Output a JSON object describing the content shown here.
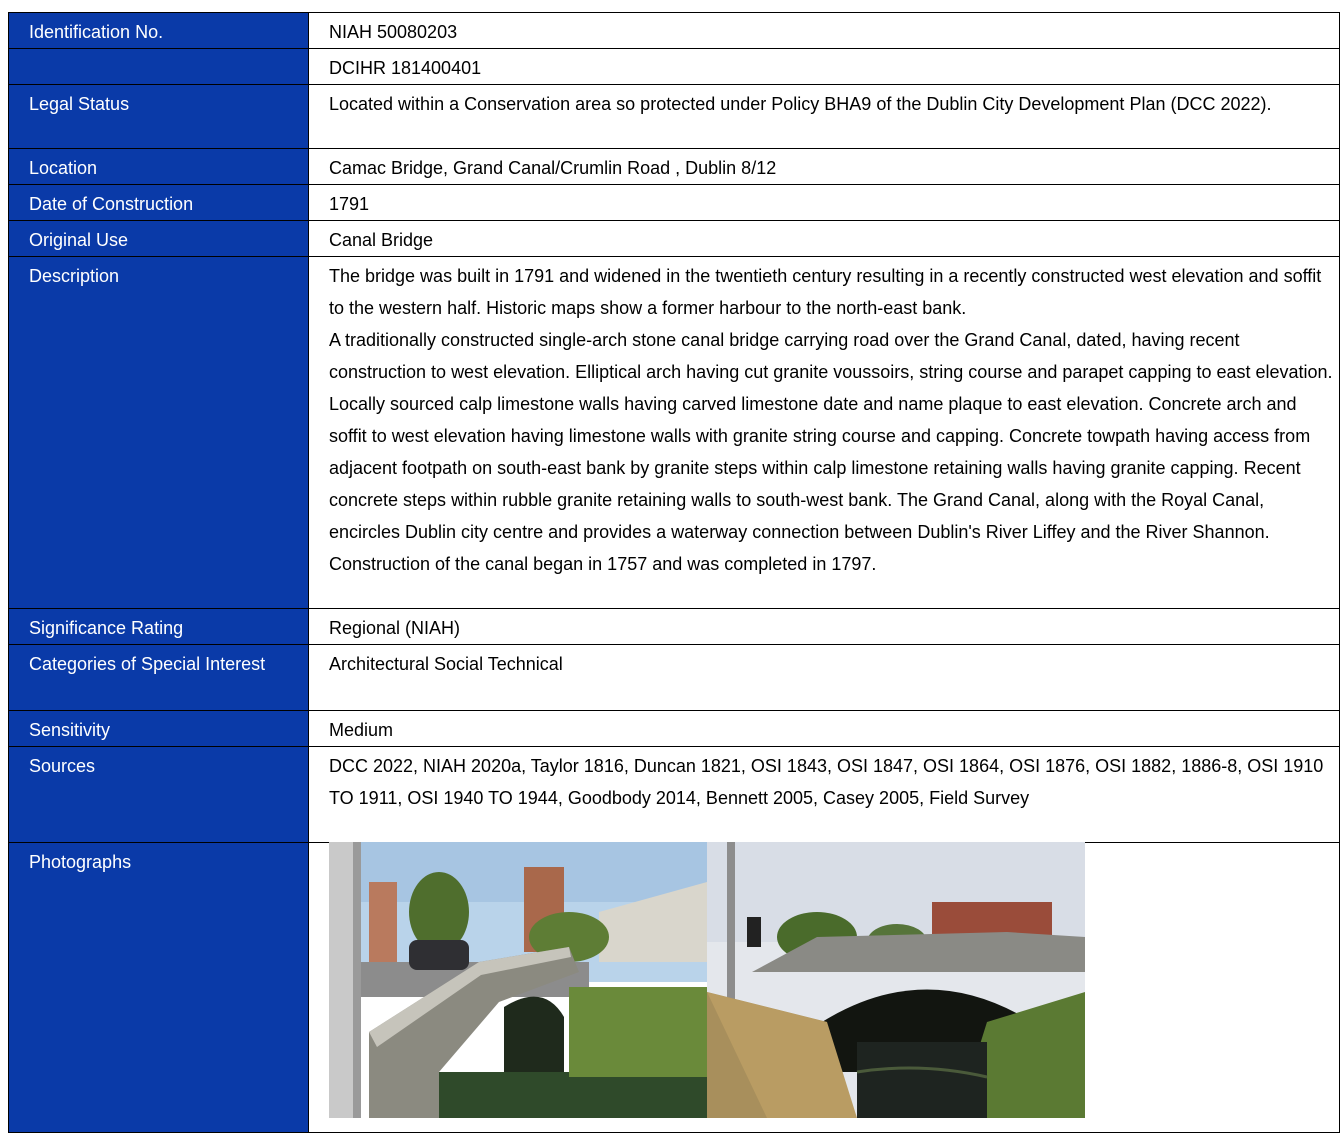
{
  "record": {
    "rows": [
      {
        "label": "Identification No.",
        "value": "NIAH 50080203"
      },
      {
        "label": "",
        "value": "DCIHR 181400401"
      },
      {
        "label": "Legal Status",
        "value": "Located within a Conservation area so protected under Policy BHA9 of the Dublin City Development Plan (DCC 2022)."
      },
      {
        "label": "Location",
        "value": "Camac Bridge, Grand Canal/Crumlin Road , Dublin 8/12"
      },
      {
        "label": "Date of Construction",
        "value": "1791"
      },
      {
        "label": "Original Use",
        "value": "Canal Bridge"
      },
      {
        "label": "Description",
        "value_p1": "The bridge was built in 1791 and widened in the twentieth century resulting in a recently constructed west elevation and soffit to the western half. Historic maps show a former harbour to the north-east bank.",
        "value_p2": "A traditionally constructed single-arch stone canal bridge carrying road over the Grand Canal, dated, having recent construction to west elevation. Elliptical arch having cut granite voussoirs, string course and parapet capping to east elevation. Locally sourced calp limestone walls having carved limestone date and name plaque to east elevation. Concrete arch and soffit to west elevation having limestone walls with granite string course and capping. Concrete towpath having access from adjacent footpath on south-east bank by granite steps within calp limestone retaining walls having granite capping. Recent concrete steps within rubble granite retaining walls to south-west bank. The Grand Canal, along with the Royal Canal, encircles Dublin city centre and provides a waterway connection between Dublin's River Liffey and the River Shannon. Construction of the canal began in 1757 and was completed in 1797."
      },
      {
        "label": "Significance Rating",
        "value": "Regional (NIAH)"
      },
      {
        "label": "Categories of Special Interest",
        "value": "Architectural Social Technical"
      },
      {
        "label": "Sensitivity",
        "value": "Medium"
      },
      {
        "label": "Sources",
        "value": "DCC 2022, NIAH 2020a, Taylor 1816, Duncan 1821, OSI 1843, OSI 1847, OSI 1864, OSI 1876, OSI 1882, 1886-8, OSI 1910 TO 1911, OSI 1940 TO 1944, Goodbody 2014, Bennett 2005, Casey 2005, Field Survey"
      },
      {
        "label": "Photographs"
      }
    ]
  },
  "colors": {
    "label_bg": "#0a3aa8",
    "label_text": "#ffffff"
  }
}
